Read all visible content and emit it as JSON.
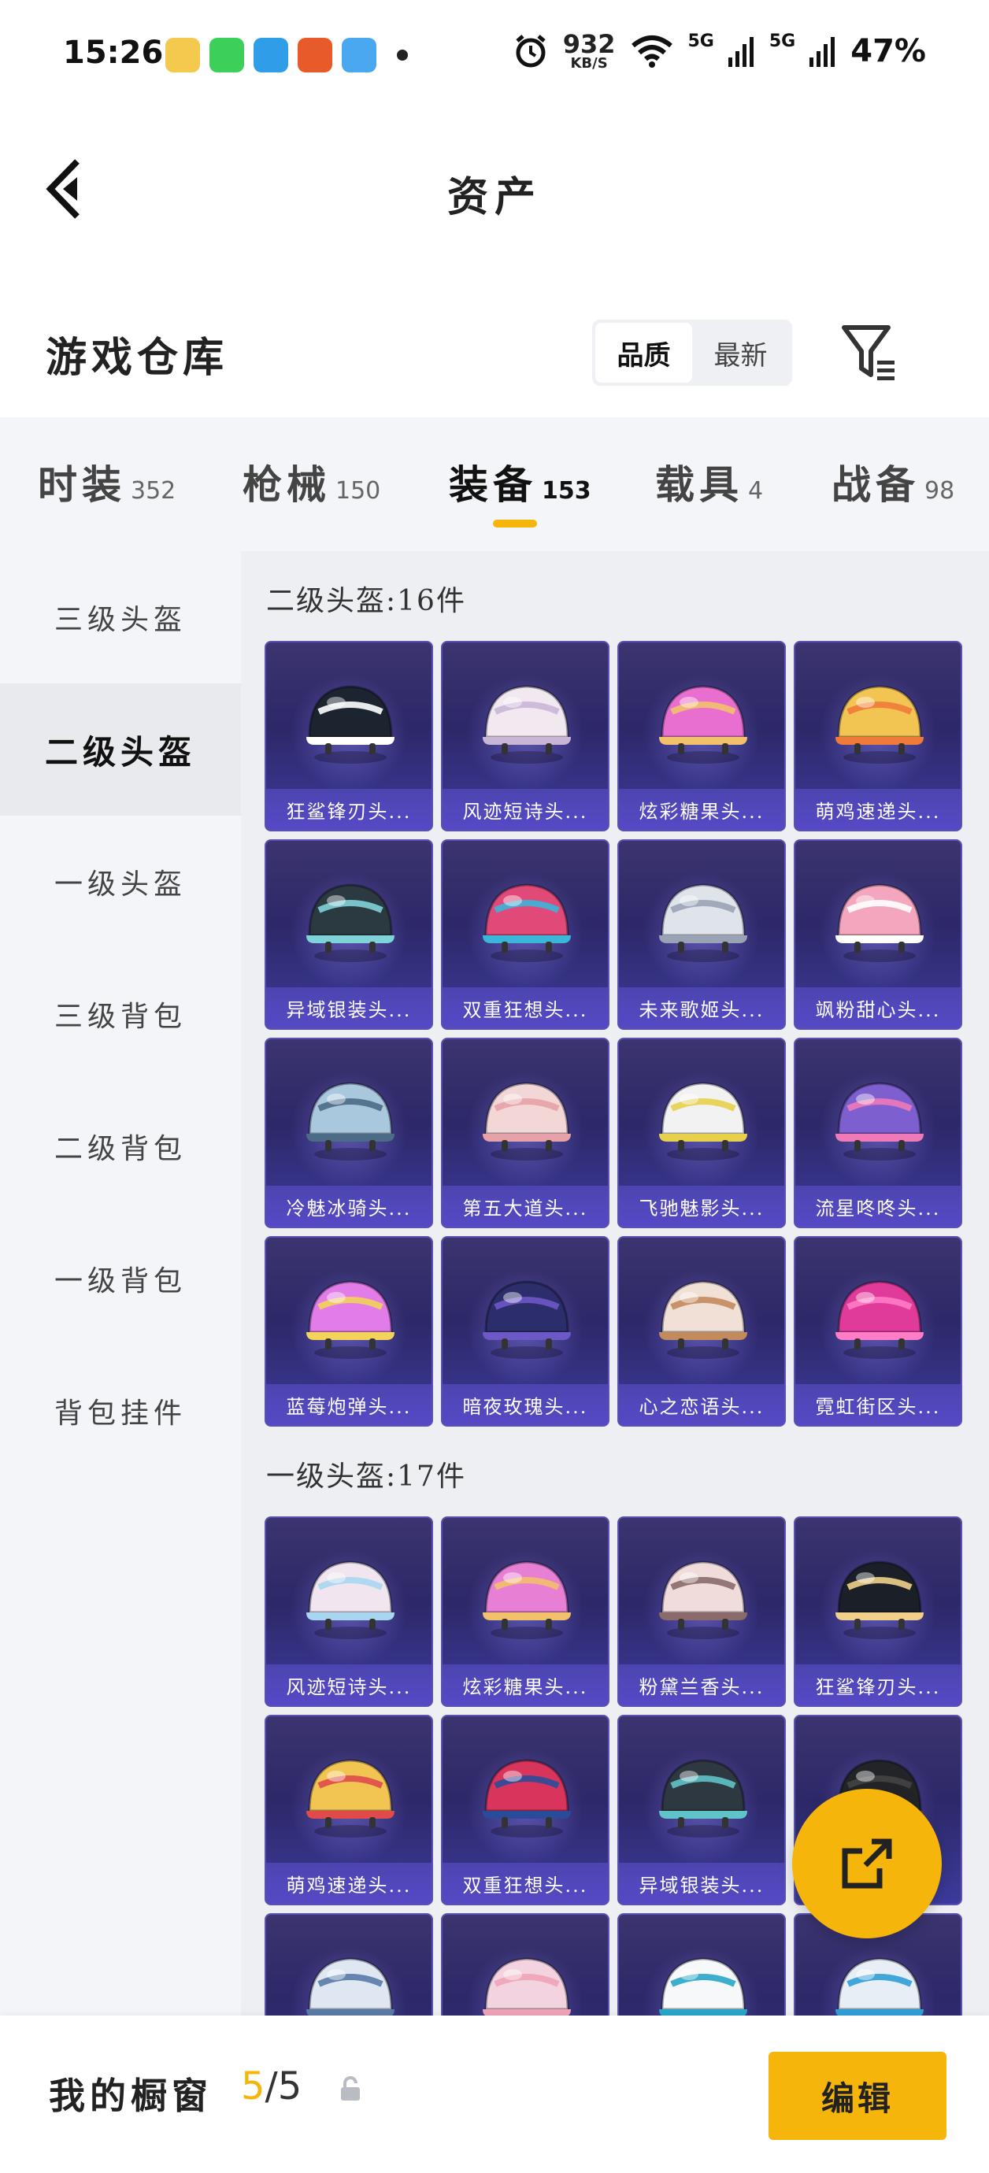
{
  "status_bar": {
    "time": "15:26",
    "net_speed": "932",
    "net_unit": "KB/S",
    "signal_1": "5G",
    "signal_2": "5G",
    "battery": "47%"
  },
  "header": {
    "title": "资产"
  },
  "warehouse": {
    "title": "游戏仓库",
    "sort_options": [
      {
        "label": "品质",
        "active": true
      },
      {
        "label": "最新",
        "active": false
      }
    ]
  },
  "tabs": [
    {
      "name": "时装",
      "count": "352",
      "active": false
    },
    {
      "name": "枪械",
      "count": "150",
      "active": false
    },
    {
      "name": "装备",
      "count": "153",
      "active": true
    },
    {
      "name": "载具",
      "count": "4",
      "active": false
    },
    {
      "name": "战备",
      "count": "98",
      "active": false
    }
  ],
  "sidebar": [
    {
      "label": "三级头盔",
      "active": false
    },
    {
      "label": "二级头盔",
      "active": true
    },
    {
      "label": "一级头盔",
      "active": false
    },
    {
      "label": "三级背包",
      "active": false
    },
    {
      "label": "二级背包",
      "active": false
    },
    {
      "label": "一级背包",
      "active": false
    },
    {
      "label": "背包挂件",
      "active": false
    }
  ],
  "sections": [
    {
      "title": "二级头盔:16件",
      "items": [
        {
          "label": "狂鲨锋刃头...",
          "color": "#1c2430",
          "accent": "#ffffff"
        },
        {
          "label": "风迹短诗头...",
          "color": "#f1e8f0",
          "accent": "#c9b6d6"
        },
        {
          "label": "炫彩糖果头...",
          "color": "#e86fd0",
          "accent": "#f3c06b"
        },
        {
          "label": "萌鸡速递头...",
          "color": "#f2c552",
          "accent": "#f07a3a"
        },
        {
          "label": "异域银装头...",
          "color": "#2b3a40",
          "accent": "#7fd3d8"
        },
        {
          "label": "双重狂想头...",
          "color": "#e14a78",
          "accent": "#3bb5d8"
        },
        {
          "label": "未来歌姬头...",
          "color": "#dfe3ea",
          "accent": "#9aa3b5"
        },
        {
          "label": "飒粉甜心头...",
          "color": "#f3a6bd",
          "accent": "#ffffff"
        },
        {
          "label": "冷魅冰骑头...",
          "color": "#a9c8de",
          "accent": "#4b6b86"
        },
        {
          "label": "第五大道头...",
          "color": "#f3d6d6",
          "accent": "#e7a1a8"
        },
        {
          "label": "飞驰魅影头...",
          "color": "#f2f2f2",
          "accent": "#e7d04a"
        },
        {
          "label": "流星咚咚头...",
          "color": "#7d5fd0",
          "accent": "#f07ab8"
        },
        {
          "label": "蓝莓炮弹头...",
          "color": "#e27ce8",
          "accent": "#f3d35a"
        },
        {
          "label": "暗夜玫瑰头...",
          "color": "#2b2e6a",
          "accent": "#6d58c8"
        },
        {
          "label": "心之恋语头...",
          "color": "#f1e0d6",
          "accent": "#c38a5e"
        },
        {
          "label": "霓虹街区头...",
          "color": "#e03a9a",
          "accent": "#ff7cc6"
        }
      ]
    },
    {
      "title": "一级头盔:17件",
      "items": [
        {
          "label": "风迹短诗头...",
          "color": "#f1e6ef",
          "accent": "#a8d6f0"
        },
        {
          "label": "炫彩糖果头...",
          "color": "#e77fd4",
          "accent": "#f3c06b"
        },
        {
          "label": "粉黛兰香头...",
          "color": "#f1dcdc",
          "accent": "#8a6a6a"
        },
        {
          "label": "狂鲨锋刃头...",
          "color": "#1b1f28",
          "accent": "#f0d08a"
        },
        {
          "label": "萌鸡速递头...",
          "color": "#f2c552",
          "accent": "#e04a4a"
        },
        {
          "label": "双重狂想头...",
          "color": "#d8345c",
          "accent": "#2b4b9a"
        },
        {
          "label": "异域银装头...",
          "color": "#2e3840",
          "accent": "#5fc3c8"
        },
        {
          "label": "",
          "color": "#222428",
          "accent": "#444"
        },
        {
          "label": "",
          "color": "#dfe8f2",
          "accent": "#5b7aa8"
        },
        {
          "label": "",
          "color": "#f3d3df",
          "accent": "#f0a3b8"
        },
        {
          "label": "",
          "color": "#f6f8fa",
          "accent": "#28a6c8"
        },
        {
          "label": "",
          "color": "#e8eef6",
          "accent": "#2f9fd8"
        }
      ]
    }
  ],
  "bottom_bar": {
    "title": "我的橱窗",
    "count_current": "5",
    "count_total": "/5",
    "edit_label": "编辑"
  },
  "colors": {
    "accent": "#f5b50a",
    "card_bg": "#2d2868",
    "card_label": "#5549c4"
  }
}
